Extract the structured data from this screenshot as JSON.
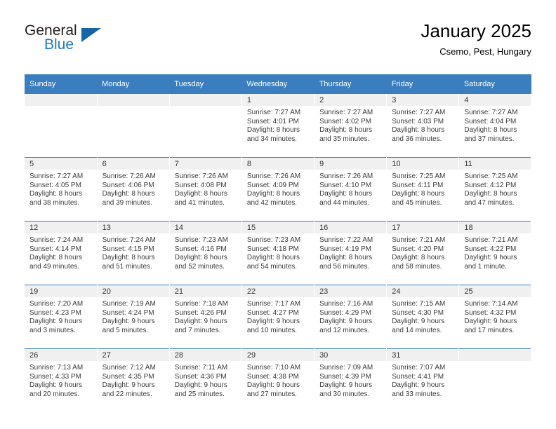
{
  "brand": {
    "name_top": "General",
    "name_bottom": "Blue",
    "triangle_color": "#1565a8",
    "blue_color": "#1f7ac4"
  },
  "header": {
    "title": "January 2025",
    "subtitle": "Csemo, Pest, Hungary"
  },
  "theme": {
    "header_bar": "#3a7ebf",
    "daynum_band": "#f0f0f0",
    "text": "#3b3b3b"
  },
  "weekdays": [
    "Sunday",
    "Monday",
    "Tuesday",
    "Wednesday",
    "Thursday",
    "Friday",
    "Saturday"
  ],
  "weeks": [
    [
      {
        "day": "",
        "sunrise": "",
        "sunset": "",
        "daylight1": "",
        "daylight2": ""
      },
      {
        "day": "",
        "sunrise": "",
        "sunset": "",
        "daylight1": "",
        "daylight2": ""
      },
      {
        "day": "",
        "sunrise": "",
        "sunset": "",
        "daylight1": "",
        "daylight2": ""
      },
      {
        "day": "1",
        "sunrise": "Sunrise: 7:27 AM",
        "sunset": "Sunset: 4:01 PM",
        "daylight1": "Daylight: 8 hours",
        "daylight2": "and 34 minutes."
      },
      {
        "day": "2",
        "sunrise": "Sunrise: 7:27 AM",
        "sunset": "Sunset: 4:02 PM",
        "daylight1": "Daylight: 8 hours",
        "daylight2": "and 35 minutes."
      },
      {
        "day": "3",
        "sunrise": "Sunrise: 7:27 AM",
        "sunset": "Sunset: 4:03 PM",
        "daylight1": "Daylight: 8 hours",
        "daylight2": "and 36 minutes."
      },
      {
        "day": "4",
        "sunrise": "Sunrise: 7:27 AM",
        "sunset": "Sunset: 4:04 PM",
        "daylight1": "Daylight: 8 hours",
        "daylight2": "and 37 minutes."
      }
    ],
    [
      {
        "day": "5",
        "sunrise": "Sunrise: 7:27 AM",
        "sunset": "Sunset: 4:05 PM",
        "daylight1": "Daylight: 8 hours",
        "daylight2": "and 38 minutes."
      },
      {
        "day": "6",
        "sunrise": "Sunrise: 7:26 AM",
        "sunset": "Sunset: 4:06 PM",
        "daylight1": "Daylight: 8 hours",
        "daylight2": "and 39 minutes."
      },
      {
        "day": "7",
        "sunrise": "Sunrise: 7:26 AM",
        "sunset": "Sunset: 4:08 PM",
        "daylight1": "Daylight: 8 hours",
        "daylight2": "and 41 minutes."
      },
      {
        "day": "8",
        "sunrise": "Sunrise: 7:26 AM",
        "sunset": "Sunset: 4:09 PM",
        "daylight1": "Daylight: 8 hours",
        "daylight2": "and 42 minutes."
      },
      {
        "day": "9",
        "sunrise": "Sunrise: 7:26 AM",
        "sunset": "Sunset: 4:10 PM",
        "daylight1": "Daylight: 8 hours",
        "daylight2": "and 44 minutes."
      },
      {
        "day": "10",
        "sunrise": "Sunrise: 7:25 AM",
        "sunset": "Sunset: 4:11 PM",
        "daylight1": "Daylight: 8 hours",
        "daylight2": "and 45 minutes."
      },
      {
        "day": "11",
        "sunrise": "Sunrise: 7:25 AM",
        "sunset": "Sunset: 4:12 PM",
        "daylight1": "Daylight: 8 hours",
        "daylight2": "and 47 minutes."
      }
    ],
    [
      {
        "day": "12",
        "sunrise": "Sunrise: 7:24 AM",
        "sunset": "Sunset: 4:14 PM",
        "daylight1": "Daylight: 8 hours",
        "daylight2": "and 49 minutes."
      },
      {
        "day": "13",
        "sunrise": "Sunrise: 7:24 AM",
        "sunset": "Sunset: 4:15 PM",
        "daylight1": "Daylight: 8 hours",
        "daylight2": "and 51 minutes."
      },
      {
        "day": "14",
        "sunrise": "Sunrise: 7:23 AM",
        "sunset": "Sunset: 4:16 PM",
        "daylight1": "Daylight: 8 hours",
        "daylight2": "and 52 minutes."
      },
      {
        "day": "15",
        "sunrise": "Sunrise: 7:23 AM",
        "sunset": "Sunset: 4:18 PM",
        "daylight1": "Daylight: 8 hours",
        "daylight2": "and 54 minutes."
      },
      {
        "day": "16",
        "sunrise": "Sunrise: 7:22 AM",
        "sunset": "Sunset: 4:19 PM",
        "daylight1": "Daylight: 8 hours",
        "daylight2": "and 56 minutes."
      },
      {
        "day": "17",
        "sunrise": "Sunrise: 7:21 AM",
        "sunset": "Sunset: 4:20 PM",
        "daylight1": "Daylight: 8 hours",
        "daylight2": "and 58 minutes."
      },
      {
        "day": "18",
        "sunrise": "Sunrise: 7:21 AM",
        "sunset": "Sunset: 4:22 PM",
        "daylight1": "Daylight: 9 hours",
        "daylight2": "and 1 minute."
      }
    ],
    [
      {
        "day": "19",
        "sunrise": "Sunrise: 7:20 AM",
        "sunset": "Sunset: 4:23 PM",
        "daylight1": "Daylight: 9 hours",
        "daylight2": "and 3 minutes."
      },
      {
        "day": "20",
        "sunrise": "Sunrise: 7:19 AM",
        "sunset": "Sunset: 4:24 PM",
        "daylight1": "Daylight: 9 hours",
        "daylight2": "and 5 minutes."
      },
      {
        "day": "21",
        "sunrise": "Sunrise: 7:18 AM",
        "sunset": "Sunset: 4:26 PM",
        "daylight1": "Daylight: 9 hours",
        "daylight2": "and 7 minutes."
      },
      {
        "day": "22",
        "sunrise": "Sunrise: 7:17 AM",
        "sunset": "Sunset: 4:27 PM",
        "daylight1": "Daylight: 9 hours",
        "daylight2": "and 10 minutes."
      },
      {
        "day": "23",
        "sunrise": "Sunrise: 7:16 AM",
        "sunset": "Sunset: 4:29 PM",
        "daylight1": "Daylight: 9 hours",
        "daylight2": "and 12 minutes."
      },
      {
        "day": "24",
        "sunrise": "Sunrise: 7:15 AM",
        "sunset": "Sunset: 4:30 PM",
        "daylight1": "Daylight: 9 hours",
        "daylight2": "and 14 minutes."
      },
      {
        "day": "25",
        "sunrise": "Sunrise: 7:14 AM",
        "sunset": "Sunset: 4:32 PM",
        "daylight1": "Daylight: 9 hours",
        "daylight2": "and 17 minutes."
      }
    ],
    [
      {
        "day": "26",
        "sunrise": "Sunrise: 7:13 AM",
        "sunset": "Sunset: 4:33 PM",
        "daylight1": "Daylight: 9 hours",
        "daylight2": "and 20 minutes."
      },
      {
        "day": "27",
        "sunrise": "Sunrise: 7:12 AM",
        "sunset": "Sunset: 4:35 PM",
        "daylight1": "Daylight: 9 hours",
        "daylight2": "and 22 minutes."
      },
      {
        "day": "28",
        "sunrise": "Sunrise: 7:11 AM",
        "sunset": "Sunset: 4:36 PM",
        "daylight1": "Daylight: 9 hours",
        "daylight2": "and 25 minutes."
      },
      {
        "day": "29",
        "sunrise": "Sunrise: 7:10 AM",
        "sunset": "Sunset: 4:38 PM",
        "daylight1": "Daylight: 9 hours",
        "daylight2": "and 27 minutes."
      },
      {
        "day": "30",
        "sunrise": "Sunrise: 7:09 AM",
        "sunset": "Sunset: 4:39 PM",
        "daylight1": "Daylight: 9 hours",
        "daylight2": "and 30 minutes."
      },
      {
        "day": "31",
        "sunrise": "Sunrise: 7:07 AM",
        "sunset": "Sunset: 4:41 PM",
        "daylight1": "Daylight: 9 hours",
        "daylight2": "and 33 minutes."
      },
      {
        "day": "",
        "sunrise": "",
        "sunset": "",
        "daylight1": "",
        "daylight2": ""
      }
    ]
  ]
}
